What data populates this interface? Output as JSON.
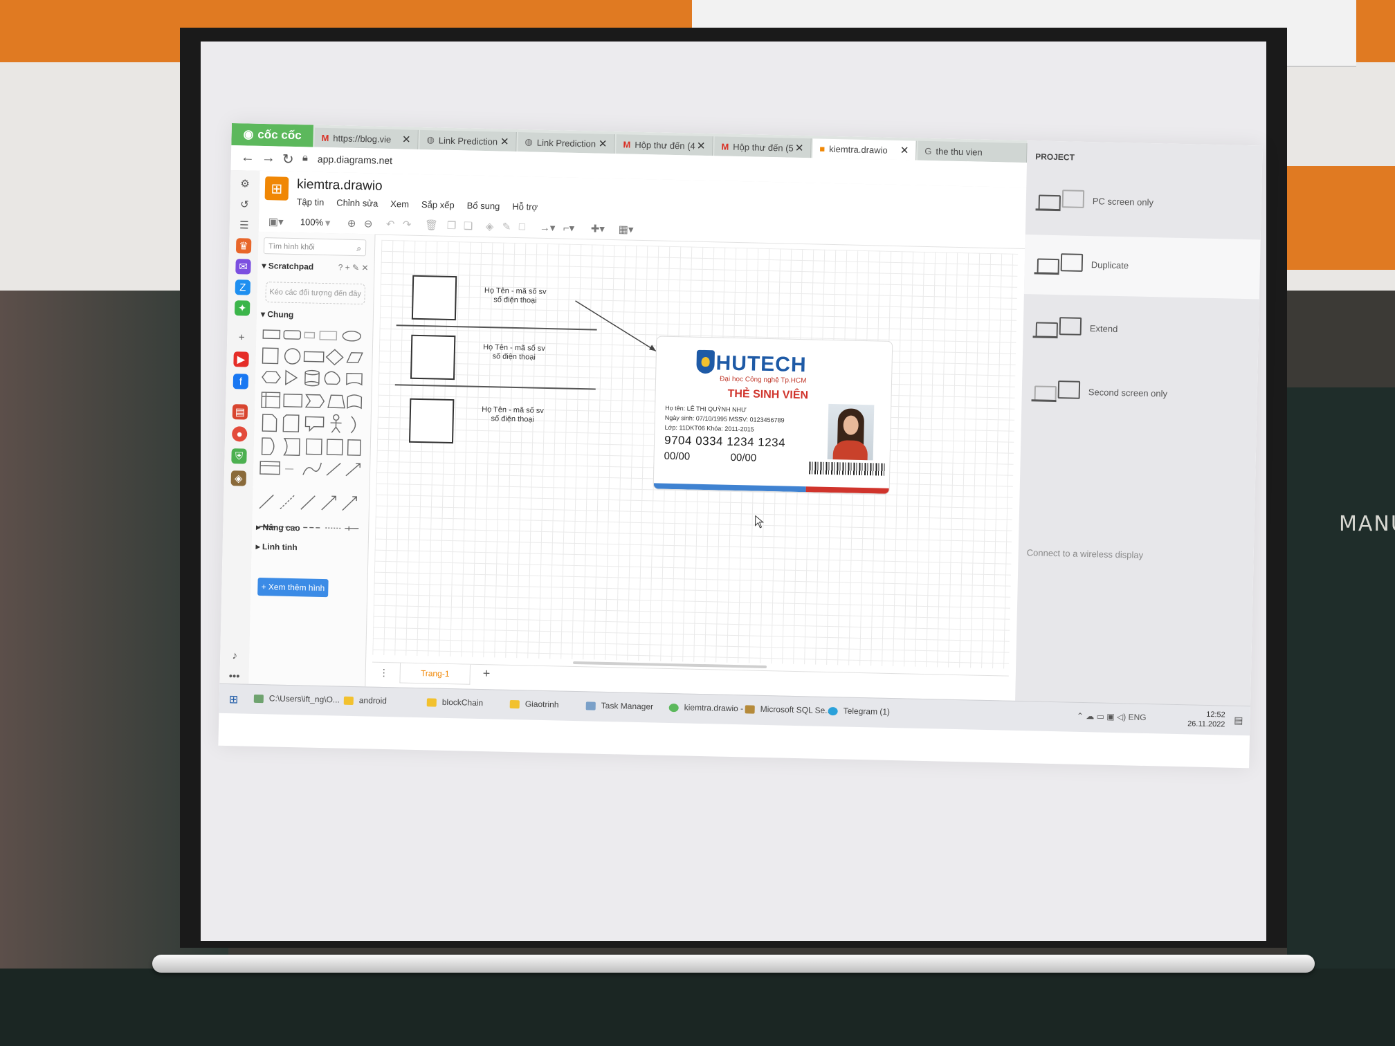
{
  "browser": {
    "brand": "cốc cốc",
    "tabs": [
      {
        "icon": "gmail-icon",
        "title": "https://blog.vie"
      },
      {
        "icon": "globe-icon",
        "title": "Link Prediction"
      },
      {
        "icon": "globe-icon",
        "title": "Link Prediction"
      },
      {
        "icon": "gmail-icon",
        "title": "Hộp thư đến (4"
      },
      {
        "icon": "gmail-icon",
        "title": "Hộp thư đến (5"
      },
      {
        "icon": "drawio-icon",
        "title": "kiemtra.drawio"
      },
      {
        "icon": "google-icon",
        "title": "the thu vien"
      }
    ],
    "url": "app.diagrams.net"
  },
  "drawio": {
    "filename": "kiemtra.drawio",
    "menus": [
      "Tập tin",
      "Chỉnh sửa",
      "Xem",
      "Sắp xếp",
      "Bổ sung",
      "Hỗ trợ"
    ],
    "zoom": "100%",
    "search_placeholder": "Tìm hình khối",
    "scratchpad_title": "Scratchpad",
    "scratchpad_tools": "? + ✎ ✕",
    "drop_hint": "Kéo các đối tượng đến đây",
    "sections": {
      "general": "Chung",
      "misc": "Linh tinh",
      "advanced": "Nâng cao"
    },
    "more_shapes_button": "+ Xem thêm hình",
    "page_tab": "Trang-1",
    "rows": [
      {
        "line1": "Họ Tên - mã số sv",
        "line2": "số điện thoại"
      },
      {
        "line1": "Họ Tên - mã số sv",
        "line2": "số điện thoại"
      },
      {
        "line1": "Họ Tên - mã số sv",
        "line2": "số điện thoại"
      }
    ],
    "card": {
      "brand": "HUTECH",
      "subtitle": "Đại học Công nghệ Tp.HCM",
      "heading": "THẺ SINH VIÊN",
      "name_line": "Họ tên: LÊ THỊ QUỲNH NHƯ",
      "dob_line": "Ngày sinh: 07/10/1995   MSSV: 0123456789",
      "class_line": "Lớp: 11DKT06   Khóa: 2011-2015",
      "number": "9704 0334 1234 1234",
      "valid_from": "00/00",
      "valid_to": "00/00"
    }
  },
  "project": {
    "title": "PROJECT",
    "options": [
      {
        "label": "PC screen only",
        "selected": false
      },
      {
        "label": "Duplicate",
        "selected": true
      },
      {
        "label": "Extend",
        "selected": false
      },
      {
        "label": "Second screen only",
        "selected": false
      }
    ],
    "wireless_link": "Connect to a wireless display"
  },
  "taskbar": {
    "items": [
      "C:\\Users\\ift_ng\\O...",
      "android",
      "blockChain",
      "Giaotrinh",
      "Task Manager",
      "kiemtra.drawio - ...",
      "Microsoft SQL Se...",
      "Telegram (1)"
    ],
    "lang": "ENG",
    "time": "12:52",
    "date": "26.11.2022"
  },
  "room": {
    "chalk_text": "MANU"
  }
}
